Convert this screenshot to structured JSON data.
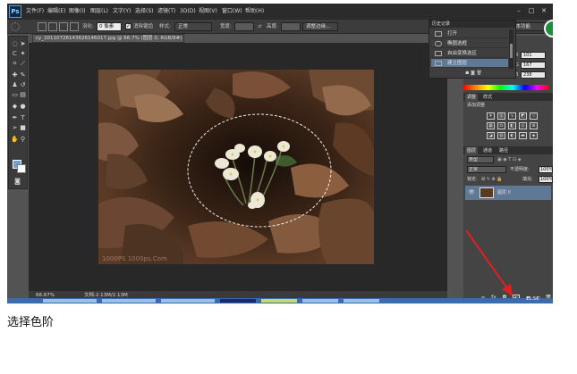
{
  "app": {
    "logo": "Ps"
  },
  "menu": [
    "文件(F)",
    "编辑(E)",
    "图像(I)",
    "图层(L)",
    "文字(Y)",
    "选择(S)",
    "滤镜(T)",
    "3D(D)",
    "视图(V)",
    "窗口(W)",
    "帮助(H)"
  ],
  "workspace": {
    "label": "基本功能"
  },
  "options": {
    "feather_label": "羽化:",
    "feather_value": "0 像素",
    "antialias_label": "消除锯齿",
    "style_label": "样式:",
    "style_value": "正常",
    "width_label": "宽度:",
    "height_label": "高度:",
    "refine_edge": "调整边缘..."
  },
  "document": {
    "tab_title": "cy_20110726143626146017.jpg @ 66.7% (图层 0, RGB/8#) *",
    "zoom": "66.67%",
    "file_info": "文档:2.13M/2.13M",
    "watermark": "1000PS 1000ps.Com"
  },
  "history": {
    "title": "历史记录",
    "items": [
      "打开",
      "椭圆选框",
      "自由变换选区",
      "建立图层"
    ],
    "selected_index": 3
  },
  "color": {
    "r": "101",
    "g": "167",
    "b": "238"
  },
  "adjustments": {
    "tabs": [
      "调整",
      "样式"
    ],
    "title": "添加调整"
  },
  "layers": {
    "tabs": [
      "图层",
      "通道",
      "路径"
    ],
    "kind": "类型",
    "blend": "正常",
    "opacity_label": "不透明度:",
    "opacity": "100%",
    "lock_label": "锁定:",
    "fill_label": "填充:",
    "fill": "100%",
    "items": [
      {
        "name": "图层 0"
      }
    ]
  },
  "clock": "21:56",
  "caption": "选择色阶",
  "colors": {
    "ps_bg": "#535353",
    "selected_blue": "#5f7896",
    "annotation_red": "#e02020",
    "fg_color": "#6fa0d8"
  }
}
